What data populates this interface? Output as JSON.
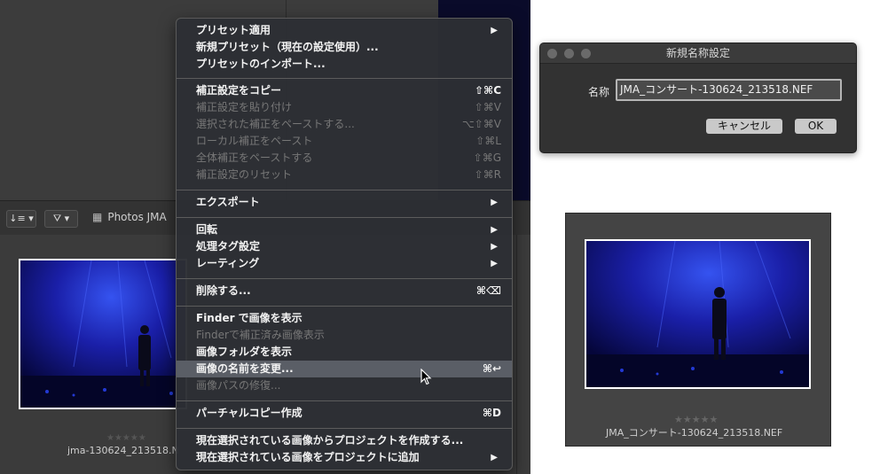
{
  "toolbar": {
    "sort_icon": "sort-icon",
    "filter_icon": "filter-icon",
    "label": "Photos JMA"
  },
  "browser": {
    "stars": "★★★★★",
    "filename": "jma-130624_213518.N"
  },
  "menu": {
    "items": [
      {
        "label": "プリセット適用",
        "shortcut": "",
        "submenu": true,
        "enabled": true
      },
      {
        "label": "新規プリセット（現在の設定使用）...",
        "shortcut": "",
        "submenu": false,
        "enabled": true
      },
      {
        "label": "プリセットのインポート...",
        "shortcut": "",
        "submenu": false,
        "enabled": true
      },
      {
        "label": "補正設定をコピー",
        "shortcut": "⇧⌘C",
        "submenu": false,
        "enabled": true
      },
      {
        "label": "補正設定を貼り付け",
        "shortcut": "⇧⌘V",
        "submenu": false,
        "enabled": false
      },
      {
        "label": "選択された補正をペーストする...",
        "shortcut": "⌥⇧⌘V",
        "submenu": false,
        "enabled": false
      },
      {
        "label": "ローカル補正をペースト",
        "shortcut": "⇧⌘L",
        "submenu": false,
        "enabled": false
      },
      {
        "label": "全体補正をペーストする",
        "shortcut": "⇧⌘G",
        "submenu": false,
        "enabled": false
      },
      {
        "label": "補正設定のリセット",
        "shortcut": "⇧⌘R",
        "submenu": false,
        "enabled": false
      },
      {
        "label": "エクスポート",
        "shortcut": "",
        "submenu": true,
        "enabled": true
      },
      {
        "label": "回転",
        "shortcut": "",
        "submenu": true,
        "enabled": true
      },
      {
        "label": "処理タグ設定",
        "shortcut": "",
        "submenu": true,
        "enabled": true
      },
      {
        "label": "レーティング",
        "shortcut": "",
        "submenu": true,
        "enabled": true
      },
      {
        "label": "削除する...",
        "shortcut": "⌘⌫",
        "submenu": false,
        "enabled": true
      },
      {
        "label": "Finder で画像を表示",
        "shortcut": "",
        "submenu": false,
        "enabled": true
      },
      {
        "label": "Finderで補正済み画像表示",
        "shortcut": "",
        "submenu": false,
        "enabled": false
      },
      {
        "label": "画像フォルダを表示",
        "shortcut": "",
        "submenu": false,
        "enabled": true
      },
      {
        "label": "画像の名前を変更...",
        "shortcut": "⌘↩",
        "submenu": false,
        "enabled": true,
        "highlighted": true
      },
      {
        "label": "画像パスの修復...",
        "shortcut": "",
        "submenu": false,
        "enabled": false
      },
      {
        "label": "パーチャルコピー作成",
        "shortcut": "⌘D",
        "submenu": false,
        "enabled": true
      },
      {
        "label": "現在選択されている画像からプロジェクトを作成する...",
        "shortcut": "",
        "submenu": false,
        "enabled": true
      },
      {
        "label": "現在選択されている画像をプロジェクトに追加",
        "shortcut": "",
        "submenu": true,
        "enabled": true
      }
    ],
    "submenu_arrow": "▶"
  },
  "dialog": {
    "title": "新規名称設定",
    "field_label": "名称",
    "field_value": "JMA_コンサート-130624_213518.NEF",
    "cancel_label": "キャンセル",
    "ok_label": "OK"
  },
  "preview": {
    "stars": "★★★★★",
    "filename": "JMA_コンサート-130624_213518.NEF"
  },
  "colors": {
    "photo_bg": "#0b0d6a",
    "photo_light": "#2a44e0",
    "menu_highlight": "#5a5e66"
  }
}
